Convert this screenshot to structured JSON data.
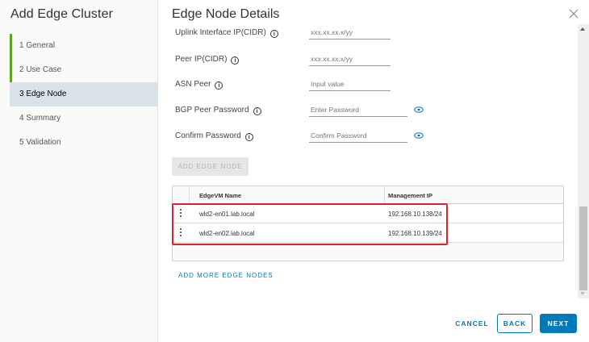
{
  "wizard": {
    "title": "Add Edge Cluster",
    "steps": [
      {
        "label": "1  General",
        "state": "done"
      },
      {
        "label": "2  Use Case",
        "state": "done"
      },
      {
        "label": "3  Edge Node",
        "state": "active"
      },
      {
        "label": "4  Summary",
        "state": "pending"
      },
      {
        "label": "5  Validation",
        "state": "pending"
      }
    ]
  },
  "main": {
    "title": "Edge Node Details",
    "fields": {
      "uplink_ip": {
        "label": "Uplink Interface IP(CIDR)",
        "placeholder": "xxx.xx.xx.x/yy"
      },
      "peer_ip": {
        "label": "Peer IP(CIDR)",
        "placeholder": "xxx.xx.xx.x/yy"
      },
      "asn_peer": {
        "label": "ASN Peer",
        "placeholder": "Input value"
      },
      "bgp_password": {
        "label": "BGP Peer Password",
        "placeholder": "Enter Password"
      },
      "confirm_password": {
        "label": "Confirm Password",
        "placeholder": "Confirm Password"
      }
    },
    "add_edge_node_label": "ADD EDGE NODE",
    "table": {
      "columns": [
        "EdgeVM Name",
        "Management IP"
      ],
      "rows": [
        {
          "name": "wld2-en01.lab.local",
          "ip": "192.168.10.138/24"
        },
        {
          "name": "wld2-en02.lab.local",
          "ip": "192.168.10.139/24"
        }
      ]
    },
    "add_more_label": "ADD MORE EDGE NODES"
  },
  "footer": {
    "cancel_label": "CANCEL",
    "back_label": "BACK",
    "next_label": "NEXT"
  },
  "icons": {
    "close": "close-icon",
    "info": "info-icon",
    "eye": "eye-icon",
    "kebab": "kebab-icon"
  },
  "colors": {
    "accent": "#0079b8",
    "step_done": "#62a420",
    "step_active_bg": "#d8e3e9",
    "highlight": "#d7262b"
  }
}
